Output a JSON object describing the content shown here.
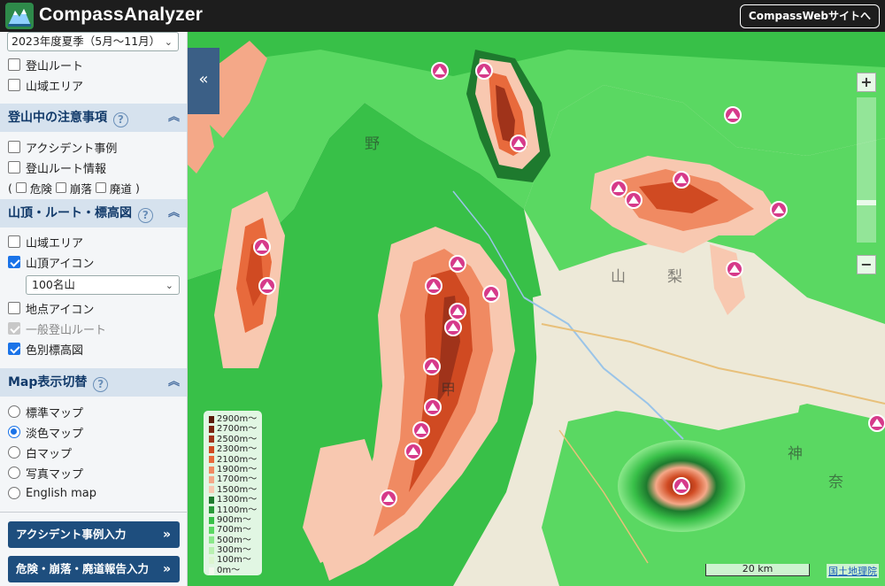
{
  "header": {
    "app_title": "CompassAnalyzer",
    "site_button": "CompassWebサイトへ"
  },
  "sidebar": {
    "season": "2023年度夏季（5月〜11月）",
    "top_items": [
      {
        "label": "登山ルート",
        "checked": false
      },
      {
        "label": "山域エリア",
        "checked": false
      }
    ],
    "caution": {
      "title": "登山中の注意事項",
      "items": [
        {
          "label": "アクシデント事例",
          "checked": false
        },
        {
          "label": "登山ルート情報",
          "checked": false
        }
      ],
      "sub_open": "(",
      "sub_close": ")",
      "sub_items": [
        "危険",
        "崩落",
        "廃道"
      ]
    },
    "summit": {
      "title": "山頂・ルート・標高図",
      "items": [
        {
          "label": "山域エリア",
          "checked": false
        },
        {
          "label": "山頂アイコン",
          "checked": true
        }
      ],
      "peak_select": "100名山",
      "items2": [
        {
          "label": "地点アイコン",
          "checked": false
        },
        {
          "label": "一般登山ルート",
          "checked": true,
          "disabled": true
        },
        {
          "label": "色別標高図",
          "checked": true
        }
      ]
    },
    "map_switch": {
      "title": "Map表示切替",
      "options": [
        {
          "label": "標準マップ",
          "selected": false
        },
        {
          "label": "淡色マップ",
          "selected": true
        },
        {
          "label": "白マップ",
          "selected": false
        },
        {
          "label": "写真マップ",
          "selected": false
        },
        {
          "label": "English map",
          "selected": false
        }
      ]
    },
    "buttons": {
      "accident": "アクシデント事例入力",
      "report": "危険・崩落・廃道報告入力"
    }
  },
  "map": {
    "collapse_symbol": "«",
    "zoom_in": "+",
    "zoom_out": "−",
    "legend": [
      {
        "label": "2900m〜",
        "color": "#5a1a0a"
      },
      {
        "label": "2700m〜",
        "color": "#7a2410"
      },
      {
        "label": "2500m〜",
        "color": "#a0331a"
      },
      {
        "label": "2300m〜",
        "color": "#d04a22"
      },
      {
        "label": "2100m〜",
        "color": "#e86a3c"
      },
      {
        "label": "1900m〜",
        "color": "#f08a62"
      },
      {
        "label": "1700m〜",
        "color": "#f4a888"
      },
      {
        "label": "1500m〜",
        "color": "#f8c8b0"
      },
      {
        "label": "1300m〜",
        "color": "#1e7a2e"
      },
      {
        "label": "1100m〜",
        "color": "#2a9a3a"
      },
      {
        "label": "900m〜",
        "color": "#38c048"
      },
      {
        "label": "700m〜",
        "color": "#5ad862"
      },
      {
        "label": "500m〜",
        "color": "#8ae88a"
      },
      {
        "label": "300m〜",
        "color": "#b8f0b0"
      },
      {
        "label": "100m〜",
        "color": "#dcf5d0"
      },
      {
        "label": "0m〜",
        "color": "#f4f8ee"
      }
    ],
    "scale": "20 km",
    "credit": "国土地理院",
    "place_labels": [
      "野",
      "山",
      "梨",
      "甲",
      "神",
      "奈"
    ]
  }
}
